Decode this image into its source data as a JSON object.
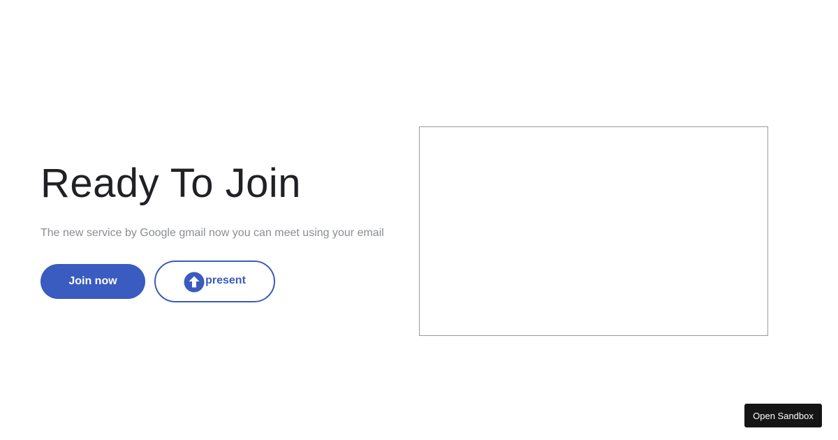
{
  "hero": {
    "title": "Ready To Join",
    "subtitle": "The new service by Google gmail now you can meet using your email"
  },
  "actions": {
    "join_label": "Join now",
    "present_label": "present",
    "present_icon": "upload-arrow-icon"
  },
  "sandbox": {
    "label": "Open Sandbox"
  },
  "colors": {
    "accent": "#3a5bbf",
    "title_text": "#202124",
    "subtitle_text": "#8a8d91",
    "sandbox_bg": "#151515"
  }
}
